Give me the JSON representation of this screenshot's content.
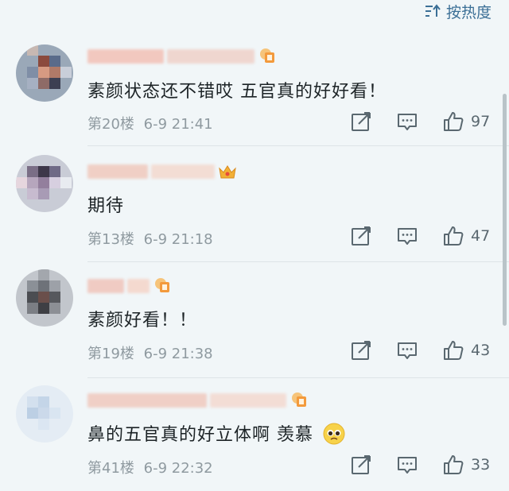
{
  "sort": {
    "label": "按热度",
    "icon": "sort-icon"
  },
  "comments": [
    {
      "text": "素颜状态还不错哎 五官真的好好看！",
      "floor": "第20楼",
      "date": "6-9 21:41",
      "likes": "97",
      "badge": "fan-badge-icon"
    },
    {
      "text": "期待",
      "floor": "第13楼",
      "date": "6-9 21:18",
      "likes": "47",
      "badge": "crown-icon"
    },
    {
      "text": "素颜好看！！",
      "floor": "第19楼",
      "date": "6-9 21:38",
      "likes": "43",
      "badge": "fan-badge-icon"
    },
    {
      "text": "鼻的五官真的好立体啊 羡慕",
      "emoji": "pleading-face-emoji",
      "floor": "第41楼",
      "date": "6-9 22:32",
      "likes": "33",
      "badge": "fan-badge-icon"
    }
  ],
  "colors": {
    "accent": "#3b6f96",
    "background": "#f1f6f8",
    "meta": "#8f9aa0"
  }
}
